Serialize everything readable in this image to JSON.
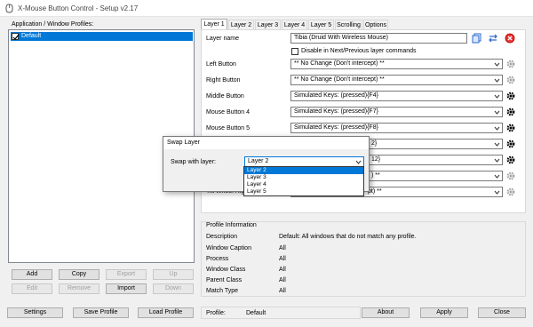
{
  "window": {
    "title": "X-Mouse Button Control - Setup v2.17"
  },
  "profiles": {
    "label": "Application / Window Profiles:",
    "items": [
      {
        "label": "Default",
        "checked": true,
        "selected": true
      }
    ],
    "buttons": {
      "add": "Add",
      "copy": "Copy",
      "export": "Export",
      "up": "Up",
      "edit": "Edit",
      "remove": "Remove",
      "import": "Import",
      "down": "Down"
    }
  },
  "tabs": [
    "Layer 1",
    "Layer 2",
    "Layer 3",
    "Layer 4",
    "Layer 5",
    "Scrolling",
    "Options"
  ],
  "layer": {
    "name_label": "Layer name",
    "name_value": "Tibia (Druid With Wireless Mouse)",
    "disable_nav_label": "Disable in Next/Previous layer commands",
    "rows": [
      {
        "label": "Left Button",
        "value": "** No Change (Don't intercept) **"
      },
      {
        "label": "Right Button",
        "value": "** No Change (Don't intercept) **"
      },
      {
        "label": "Middle Button",
        "value": "Simulated Keys: (pressed){F4}"
      },
      {
        "label": "Mouse Button 4",
        "value": "Simulated Keys: (pressed){F7}"
      },
      {
        "label": "Mouse Button 5",
        "value": "Simulated Keys: (pressed){F8}"
      },
      {
        "label": "",
        "value": "2}"
      },
      {
        "label": "",
        "value": "12}"
      },
      {
        "label": "",
        "value": ") **"
      },
      {
        "label": "Tilt Wheel Righ",
        "value": "pt) **"
      }
    ]
  },
  "profile_info": {
    "title": "Profile Information",
    "rows": [
      {
        "key": "Description",
        "value": "Default: All windows that do not match any profile."
      },
      {
        "key": "Window Caption",
        "value": "All"
      },
      {
        "key": "Process",
        "value": "All"
      },
      {
        "key": "Window Class",
        "value": "All"
      },
      {
        "key": "Parent Class",
        "value": "All"
      },
      {
        "key": "Match Type",
        "value": "All"
      }
    ]
  },
  "bottom": {
    "settings": "Settings",
    "save_profile": "Save Profile",
    "load_profile": "Load Profile",
    "profile_label": "Profile:",
    "profile_value": "Default",
    "about": "About",
    "apply": "Apply",
    "close": "Close"
  },
  "dialog": {
    "title": "Swap Layer",
    "label": "Swap with layer:",
    "selected": "Layer 2",
    "options": [
      "Layer 2",
      "Layer 3",
      "Layer 4",
      "Layer 5"
    ]
  },
  "colors": {
    "selection": "#0078d7",
    "gear": "#000000"
  }
}
